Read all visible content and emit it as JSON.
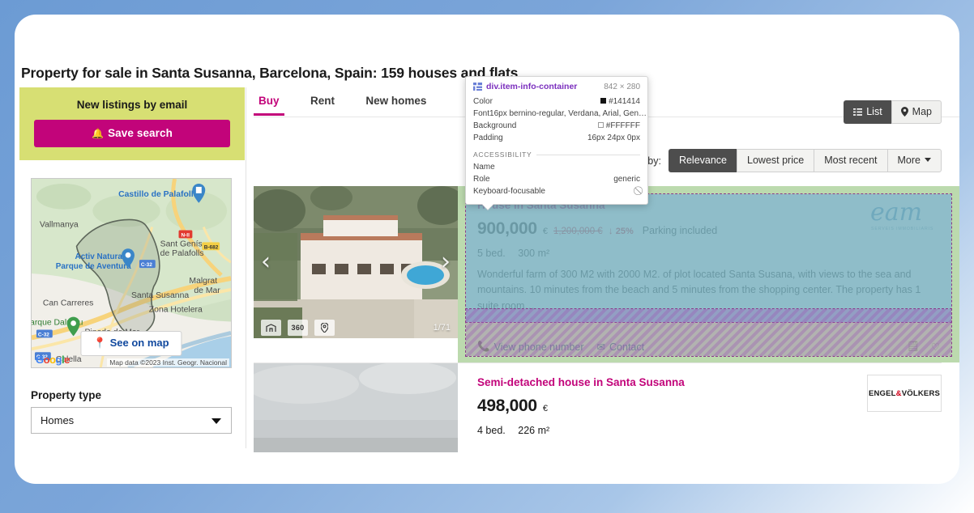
{
  "page": {
    "title": "Property for sale in Santa Susanna, Barcelona, Spain: 159 houses and flats"
  },
  "sidebar": {
    "alert": {
      "title": "New listings by email",
      "save_label": "Save search",
      "bell_icon": "bell-icon"
    },
    "map": {
      "see_on_map_label": "See on map",
      "pin_icon": "map-pin-icon",
      "attribution": "Map data ©2023 Inst. Geogr. Nacional",
      "logo": "Google",
      "labels": [
        "Castillo de Palafolls",
        "Vallmanya",
        "Sant Genís",
        "de Palafolls",
        "Activ Natura",
        "Parque de Aventura",
        "Malgrat",
        "de Mar",
        "Santa Susanna",
        "Can Carreres",
        "Zona Hotelera",
        "arque Dalmau",
        "Pineda de Mar",
        "Calella"
      ],
      "road_shields": [
        "N-II",
        "B-682",
        "C-32",
        "C-32",
        "C-32"
      ]
    },
    "filters": {
      "property_type_label": "Property type",
      "property_type_value": "Homes"
    }
  },
  "main": {
    "tabs": [
      {
        "label": "Buy",
        "active": true
      },
      {
        "label": "Rent",
        "active": false
      },
      {
        "label": "New homes",
        "active": false
      }
    ],
    "view_toggle": [
      {
        "label": "List",
        "icon": "list-icon",
        "active": true
      },
      {
        "label": "Map",
        "icon": "map-pin-icon",
        "active": false
      }
    ],
    "sort": {
      "label": "Sort by:",
      "options": [
        {
          "label": "Relevance",
          "active": true
        },
        {
          "label": "Lowest price",
          "active": false
        },
        {
          "label": "Most recent",
          "active": false
        },
        {
          "label": "More",
          "active": false,
          "caret": true
        }
      ]
    },
    "listings": [
      {
        "title": "House in Santa Susanna",
        "price": "900,000",
        "currency": "€",
        "old_price": "1,200,000 €",
        "discount": "25%",
        "discount_arrow": "↓",
        "extra": "Parking included",
        "specs": [
          "5 bed.",
          "300 m²"
        ],
        "description": "Wonderful farm of 300 M2 with 2000 M2. of plot located Santa Susana, with views to the sea and mountains. 10 minutes from the beach and 5 minutes from the shopping center. The property has 1 suite room…",
        "actions": [
          {
            "label": "View phone number",
            "icon": "phone-icon"
          },
          {
            "label": "Contact",
            "icon": "mail-icon"
          }
        ],
        "right_icons": [
          "note-icon",
          "heart-icon"
        ],
        "brand": "eam",
        "brand_sub": "SERVEIS IMMOBILIARIS",
        "thumb": {
          "photo_count": "1/71",
          "icons": [
            "floorplan-icon",
            "360",
            "map-pin-icon"
          ],
          "prev_icon": "chevron-left-icon",
          "next_icon": "chevron-right-icon"
        }
      },
      {
        "title": "Semi-detached house in Santa Susanna",
        "price": "498,000",
        "currency": "€",
        "specs": [
          "4 bed.",
          "226 m²"
        ],
        "brand_name": "ENGEL",
        "brand_amp": "&",
        "brand_name2": "VÖLKERS"
      }
    ]
  },
  "inspector": {
    "selector": "div.item-info-container",
    "dimensions": "842 × 280",
    "badge_icon": "grid-badge-icon",
    "rows": [
      {
        "key": "Color",
        "value": "#141414",
        "swatch": "dark"
      },
      {
        "key": "Font",
        "value": "16px bernino-regular, Verdana, Arial, Gen…"
      },
      {
        "key": "Background",
        "value": "#FFFFFF",
        "swatch": "light"
      },
      {
        "key": "Padding",
        "value": "16px 24px 0px"
      }
    ],
    "a11y_heading": "ACCESSIBILITY",
    "a11y_rows": [
      {
        "key": "Name",
        "value": ""
      },
      {
        "key": "Role",
        "value": "generic"
      },
      {
        "key": "Keyboard-focusable",
        "value": "⃠"
      }
    ]
  },
  "colors": {
    "accent_pink": "#c2047a",
    "alert_green": "#d7df73",
    "dark_button": "#4d4d4d",
    "link_blue": "#1b4ea3",
    "discount_red": "#d0021b",
    "highlight_margin": "#93c47d",
    "highlight_content": "#6fa8dc",
    "highlight_padding": "#9b59b6"
  }
}
